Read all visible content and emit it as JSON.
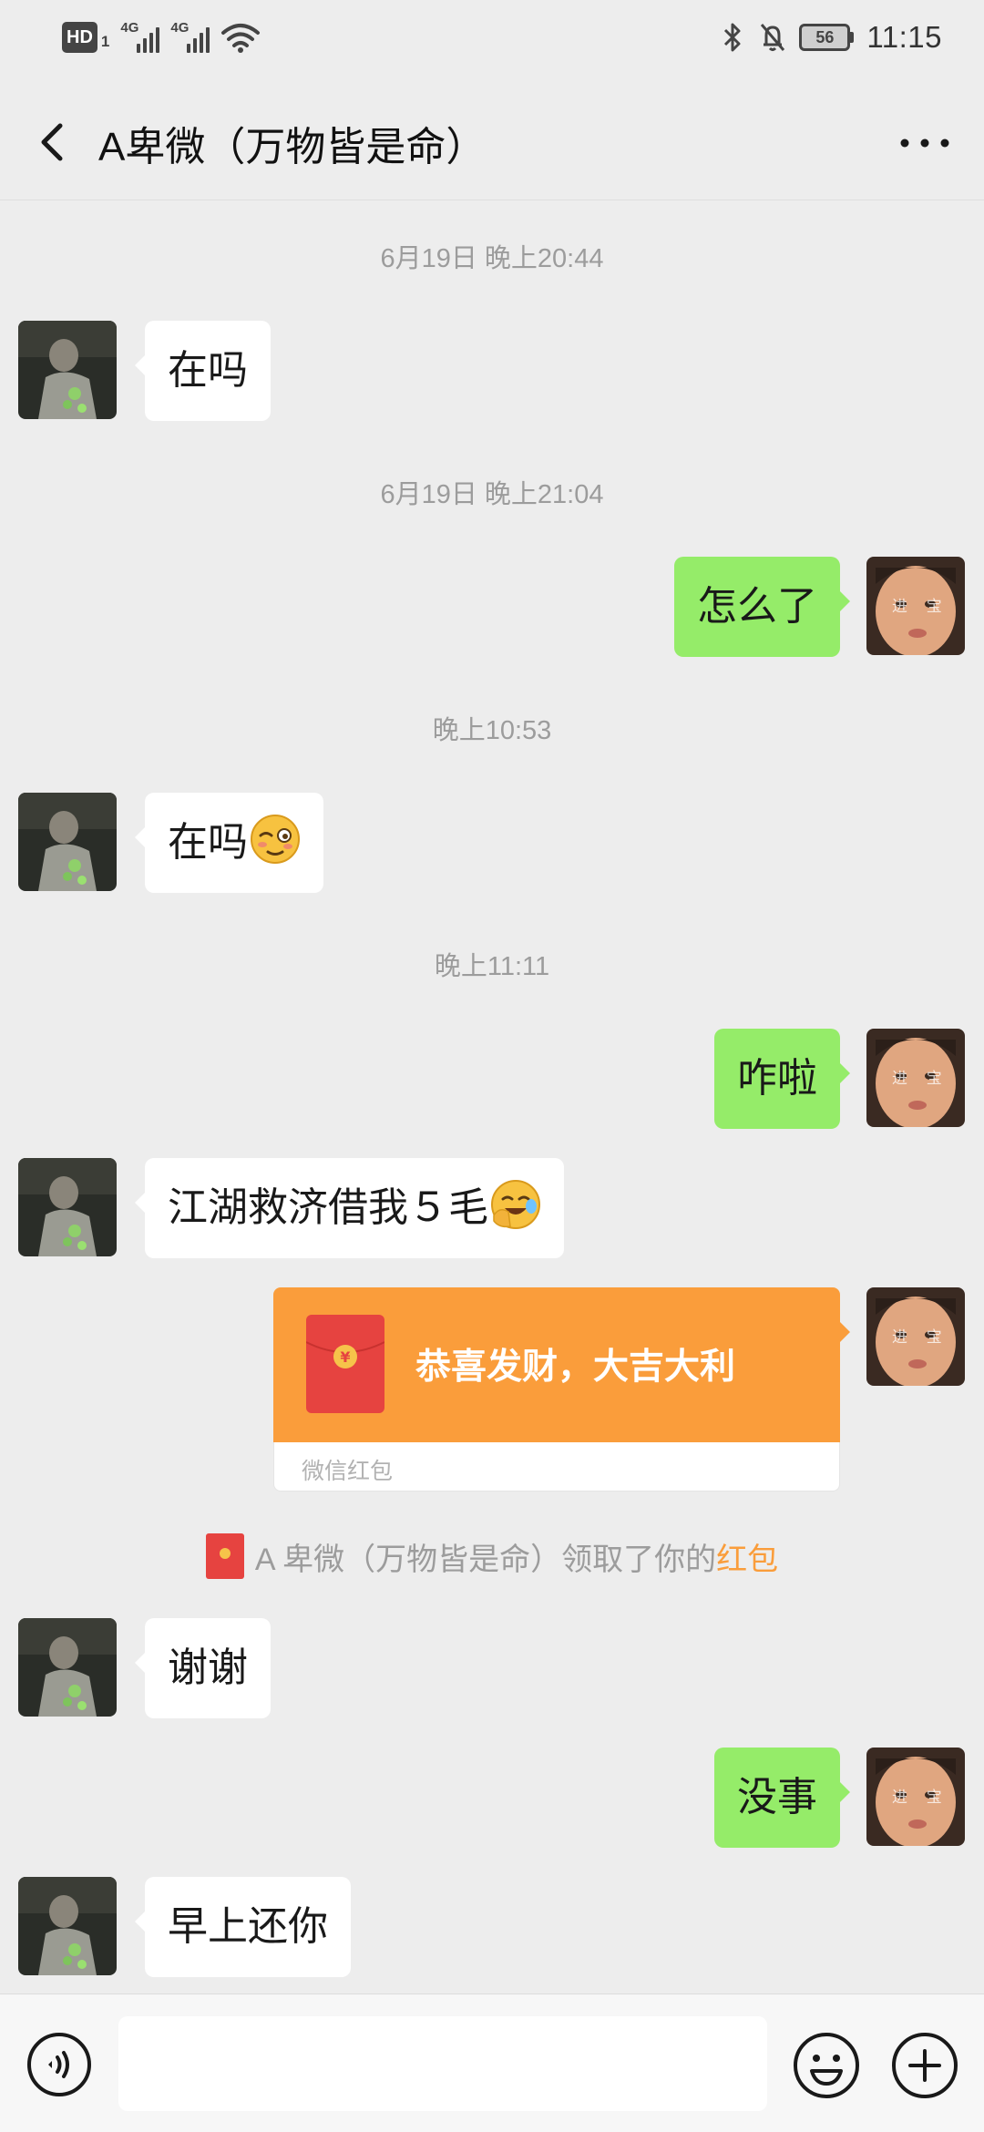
{
  "status_bar": {
    "hd": "HD",
    "hd_sub": "1",
    "sim1_tag": "4G",
    "sim2_tag": "4G",
    "battery": "56",
    "time": "11:15",
    "icons": [
      "wifi-icon",
      "bluetooth-icon",
      "mute-icon",
      "battery-icon"
    ]
  },
  "header": {
    "title": "A卑微（万物皆是命）",
    "icons": [
      "back-arrow-icon",
      "more-dots-icon"
    ]
  },
  "timestamps": {
    "t1": "6月19日 晚上20:44",
    "t2": "6月19日 晚上21:04",
    "t3": "晚上10:53",
    "t4": "晚上11:11"
  },
  "messages": {
    "m1": "在吗",
    "m2": "怎么了",
    "m3": "在吗",
    "m4": "咋啦",
    "m5": "江湖救济借我５毛",
    "m6": "谢谢",
    "m7": "没事",
    "m8": "早上还你"
  },
  "emojis": {
    "m3": "blushing-face-emoji",
    "m5": "facepalm-laugh-emoji"
  },
  "red_packet": {
    "title": "恭喜发财，大吉大利",
    "brand": "微信红包",
    "symbol": "¥"
  },
  "system_notice": {
    "text": "A 卑微（万物皆是命）领取了你的",
    "link": "红包"
  },
  "avatars": {
    "left_text": "",
    "right_text": "进 宝"
  },
  "input_bar": {
    "placeholder": "",
    "icons": [
      "voice-icon",
      "emoji-icon",
      "plus-icon"
    ]
  },
  "colors": {
    "background": "#ededed",
    "bubble_out": "#95ec69",
    "bubble_in": "#ffffff",
    "red_packet": "#fa9d3b",
    "red_packet_link": "#fa9d3b",
    "timestamp": "#9c9c9c"
  }
}
